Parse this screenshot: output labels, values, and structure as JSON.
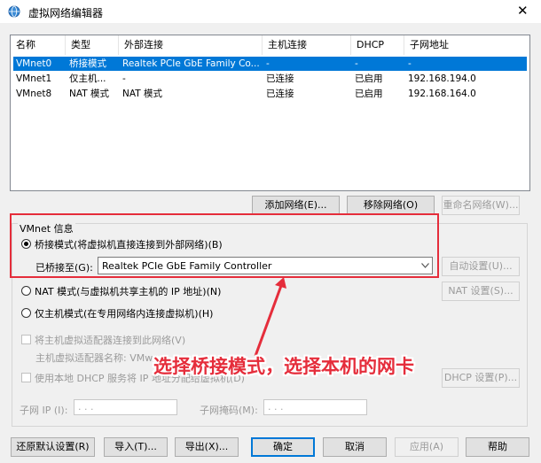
{
  "window": {
    "title": "虚拟网络编辑器",
    "close_label": "✕"
  },
  "table": {
    "headers": [
      "名称",
      "类型",
      "外部连接",
      "主机连接",
      "DHCP",
      "子网地址"
    ],
    "rows": [
      [
        "VMnet0",
        "桥接模式",
        "Realtek PCIe GbE Family Co...",
        "-",
        "-",
        "-"
      ],
      [
        "VMnet1",
        "仅主机...",
        "-",
        "已连接",
        "已启用",
        "192.168.194.0"
      ],
      [
        "VMnet8",
        "NAT 模式",
        "NAT 模式",
        "已连接",
        "已启用",
        "192.168.164.0"
      ]
    ],
    "selected_row": 0
  },
  "table_buttons": {
    "add": "添加网络(E)...",
    "remove": "移除网络(O)",
    "rename": "重命名网络(W)..."
  },
  "vmnet_info": {
    "title": "VMnet 信息",
    "bridged": "桥接模式(将虚拟机直接连接到外部网络)(B)",
    "bridged_to_label": "已桥接至(G):",
    "bridged_to_value": "Realtek PCIe GbE Family Controller",
    "auto_settings": "自动设置(U)...",
    "nat": "NAT 模式(与虚拟机共享主机的 IP 地址)(N)",
    "nat_settings": "NAT 设置(S)...",
    "host_only": "仅主机模式(在专用网络内连接虚拟机)(H)",
    "connect_adapter": "将主机虚拟适配器连接到此网络(V)",
    "adapter_name": "主机虚拟适配器名称: VMware",
    "use_dhcp": "使用本地 DHCP 服务将 IP 地址分配给虚拟机(D)",
    "dhcp_settings": "DHCP 设置(P)...",
    "subnet_ip": "子网 IP (I):",
    "subnet_mask": "子网掩码(M):",
    "ip_placeholder": ".       .       ."
  },
  "annotation": "选择桥接模式，选择本机的网卡",
  "footer": {
    "restore": "还原默认设置(R)",
    "import": "导入(T)...",
    "export": "导出(X)...",
    "ok": "确定",
    "cancel": "取消",
    "apply": "应用(A)",
    "help": "帮助"
  },
  "colors": {
    "selection": "#0078d7",
    "annotation": "#e52d3b"
  }
}
